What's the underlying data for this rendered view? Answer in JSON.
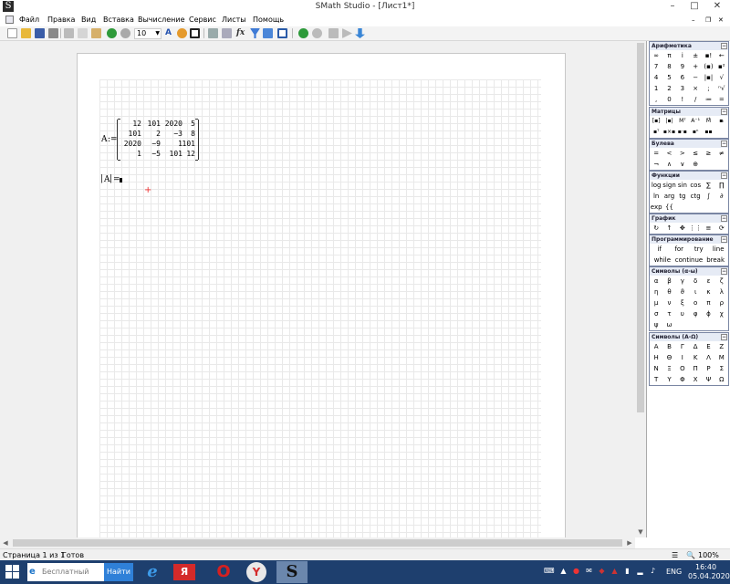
{
  "window": {
    "app_icon": "S",
    "title": "SMath Studio - [Лист1*]",
    "minimize": "–",
    "maximize": "□",
    "close": "✕",
    "inner_minimize": "–",
    "inner_restore": "❐",
    "inner_close": "✕"
  },
  "menu": [
    "Файл",
    "Правка",
    "Вид",
    "Вставка",
    "Вычисление",
    "Сервис",
    "Листы",
    "Помощь"
  ],
  "toolbar": {
    "font_size": "10",
    "text_color_letter": "A",
    "function_label": "fx"
  },
  "worksheet": {
    "matrix_var": "A",
    "define_op": ":=",
    "matrix": [
      [
        "12",
        "101",
        "2020",
        "5"
      ],
      [
        "101",
        "2",
        "−3",
        "8"
      ],
      [
        "2020",
        "−9",
        "1",
        "101"
      ],
      [
        "1",
        "−5",
        "101",
        "12"
      ]
    ],
    "det_expr_bar_open": "|",
    "det_expr_var": "A",
    "det_expr_bar_close": "|",
    "det_equals": "=",
    "placeholder_cross": "+"
  },
  "panels": {
    "arithmetic": {
      "title": "Арифметика",
      "rows": [
        [
          "∞",
          "π",
          "i",
          "±",
          "▪!",
          "←"
        ],
        [
          "7",
          "8",
          "9",
          "+",
          "(▪)",
          "▪²"
        ],
        [
          "4",
          "5",
          "6",
          "−",
          "|▪|",
          "√"
        ],
        [
          "1",
          "2",
          "3",
          "×",
          ";",
          "ⁿ√"
        ],
        [
          ",",
          "0",
          "!",
          "/",
          "≔",
          "="
        ]
      ]
    },
    "matrices": {
      "title": "Матрицы",
      "rows": [
        [
          "[▪]",
          "|▪|",
          "Mᵀ",
          "A⁻¹",
          "M⃗",
          "▪ᵢ"
        ],
        [
          "▪ᵀ",
          "▪×▪",
          "▪·▪",
          "▪ⁿ",
          "▪▪",
          ""
        ]
      ]
    },
    "boolean": {
      "title": "Булева",
      "rows": [
        [
          "=",
          "<",
          ">",
          "≤",
          "≥",
          "≠"
        ],
        [
          "¬",
          "∧",
          "∨",
          "⊕",
          "",
          ""
        ]
      ]
    },
    "functions": {
      "title": "Функции",
      "rows": [
        [
          "log",
          "sign",
          "sin",
          "cos",
          "∑",
          "∏"
        ],
        [
          "ln",
          "arg",
          "tg",
          "ctg",
          "∫",
          "∂"
        ],
        [
          "exp",
          "{{",
          "",
          "",
          "",
          ""
        ]
      ]
    },
    "graph": {
      "title": "График",
      "rows": [
        [
          "↻",
          "↑",
          "✥",
          "⋮⋮",
          "≡",
          "⟳"
        ]
      ]
    },
    "programming": {
      "title": "Программирование",
      "rows": [
        [
          "if",
          "for",
          "try",
          "line"
        ],
        [
          "while",
          "continue",
          "break"
        ]
      ]
    },
    "greek_lower": {
      "title": "Символы (α-ω)",
      "rows": [
        [
          "α",
          "β",
          "γ",
          "δ",
          "ε",
          "ζ"
        ],
        [
          "η",
          "θ",
          "ϑ",
          "ι",
          "κ",
          "λ"
        ],
        [
          "μ",
          "ν",
          "ξ",
          "ο",
          "π",
          "ρ"
        ],
        [
          "σ",
          "τ",
          "υ",
          "φ",
          "ϕ",
          "χ"
        ],
        [
          "ψ",
          "ω",
          "",
          "",
          "",
          ""
        ]
      ]
    },
    "greek_upper": {
      "title": "Символы (A-Ω)",
      "rows": [
        [
          "Α",
          "Β",
          "Γ",
          "Δ",
          "Ε",
          "Ζ"
        ],
        [
          "Η",
          "Θ",
          "Ι",
          "Κ",
          "Λ",
          "Μ"
        ],
        [
          "Ν",
          "Ξ",
          "Ο",
          "Π",
          "Ρ",
          "Σ"
        ],
        [
          "Τ",
          "Υ",
          "Φ",
          "Χ",
          "Ψ",
          "Ω"
        ]
      ]
    }
  },
  "status": {
    "page": "Страница 1 из 1",
    "state": "Готов",
    "zoom": "100%"
  },
  "taskbar": {
    "search_placeholder": "Бесплатный ар...",
    "search_button": "Найти",
    "lang": "ENG",
    "time": "16:40",
    "date": "05.04.2020"
  }
}
